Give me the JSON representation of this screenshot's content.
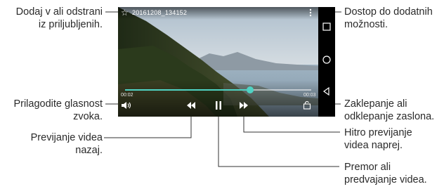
{
  "player": {
    "file_name": "20161208_134152",
    "time_elapsed": "00:02",
    "time_total": "00:03",
    "progress": 0.67
  },
  "callouts": {
    "favorite": "Dodaj v ali odstrani\niz priljubljenih.",
    "more_options": "Dostop do dodatnih\nmožnosti.",
    "volume": "Prilagodite glasnost\nzvoka.",
    "lock": "Zaklepanje ali\nodklepanje zaslona.",
    "rewind": "Previjanje videa\nnazaj.",
    "fast_forward": "Hitro previjanje\nvidea naprej.",
    "pause": "Premor ali\npredvajanje videa."
  },
  "icons": {
    "favorite": "star-icon",
    "more": "more-vertical-icon",
    "volume": "volume-icon",
    "rewind": "rewind-icon",
    "pause": "pause-icon",
    "fast_forward": "fast-forward-icon",
    "lock": "screen-lock-icon",
    "nav_recent": "recent-apps-icon",
    "nav_home": "home-icon",
    "nav_back": "back-icon"
  },
  "colors": {
    "accent": "#4fd3c4",
    "leader": "#333333"
  }
}
